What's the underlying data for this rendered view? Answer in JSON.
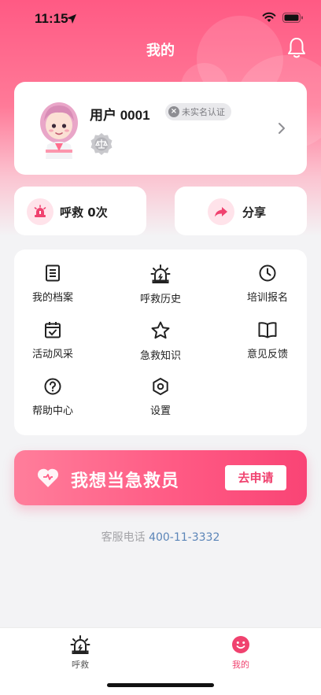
{
  "status_bar": {
    "time": "11:15"
  },
  "header": {
    "title": "我的"
  },
  "profile": {
    "username": "用户 0001",
    "verify_badge": "未实名认证"
  },
  "stats": {
    "rescue_label": "呼救",
    "rescue_count": "0",
    "rescue_unit": "次",
    "share_label": "分享"
  },
  "menu": {
    "items": [
      {
        "label": "我的档案",
        "icon": "document-icon"
      },
      {
        "label": "呼救历史",
        "icon": "alarm-icon"
      },
      {
        "label": "培训报名",
        "icon": "clock-icon"
      },
      {
        "label": "活动风采",
        "icon": "calendar-check-icon"
      },
      {
        "label": "急救知识",
        "icon": "star-icon"
      },
      {
        "label": "意见反馈",
        "icon": "book-icon"
      },
      {
        "label": "帮助中心",
        "icon": "help-icon"
      },
      {
        "label": "设置",
        "icon": "settings-icon"
      }
    ]
  },
  "banner": {
    "text": "我想当急救员",
    "button_label": "去申请"
  },
  "hotline": {
    "label": "客服电话",
    "phone": "400-11-3332"
  },
  "tabbar": {
    "items": [
      {
        "label": "呼救",
        "icon": "alarm-icon"
      },
      {
        "label": "我的",
        "icon": "smile-icon",
        "active": true
      }
    ]
  },
  "colors": {
    "brand": "#f94475",
    "phone_link": "#5b85b8"
  }
}
